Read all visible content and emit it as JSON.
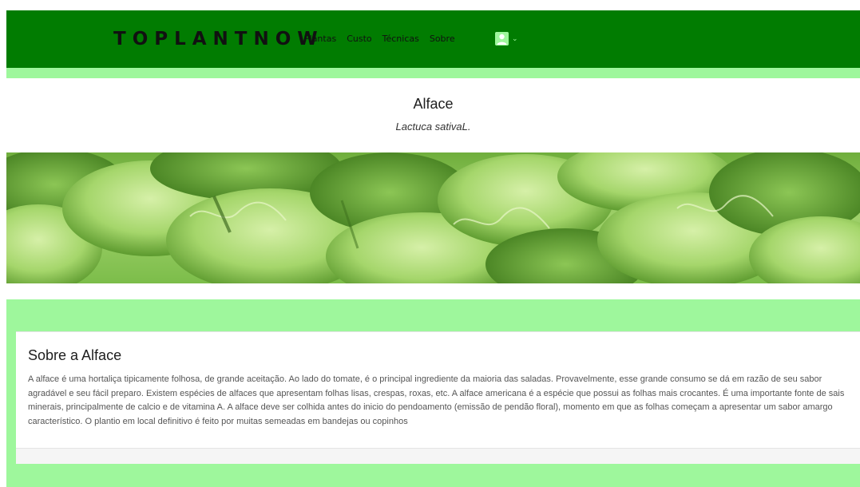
{
  "brand": "TOPLANTNOW",
  "nav": {
    "links": [
      "Plantas",
      "Custo",
      "Técnicas",
      "Sobre"
    ],
    "user_icon": "user-icon",
    "dropdown_icon": "chevron-down-icon"
  },
  "plant": {
    "name": "Alface",
    "scientific_name": "Lactuca sativaL."
  },
  "hero": {
    "icon": "lettuce-leaves-photo"
  },
  "about": {
    "title": "Sobre a Alface",
    "text": "A alface é uma hortaliça tipicamente folhosa, de grande aceitação. Ao lado do tomate, é o principal ingrediente da maioria das saladas. Provavelmente, esse grande consumo se dá em razão de seu sabor agradável e seu fácil preparo. Existem espécies de alfaces que apresentam folhas lisas, crespas, roxas, etc. A alface americana é a espécie que possui as folhas mais crocantes. É uma importante fonte de sais minerais, principalmente de calcio e de vitamina A. A alface deve ser colhida antes do inicio do pendoamento (emissão de pendão floral), momento em que as folhas começam a apresentar um sabor amargo característico. O plantio em local definitivo é feito por muitas semeadas em bandejas ou copinhos"
  },
  "colors": {
    "navbar": "#017c01",
    "page_background": "#9ef79c",
    "panel": "#ffffff",
    "text_dark": "#1e1e1e",
    "text_body": "#555555"
  }
}
